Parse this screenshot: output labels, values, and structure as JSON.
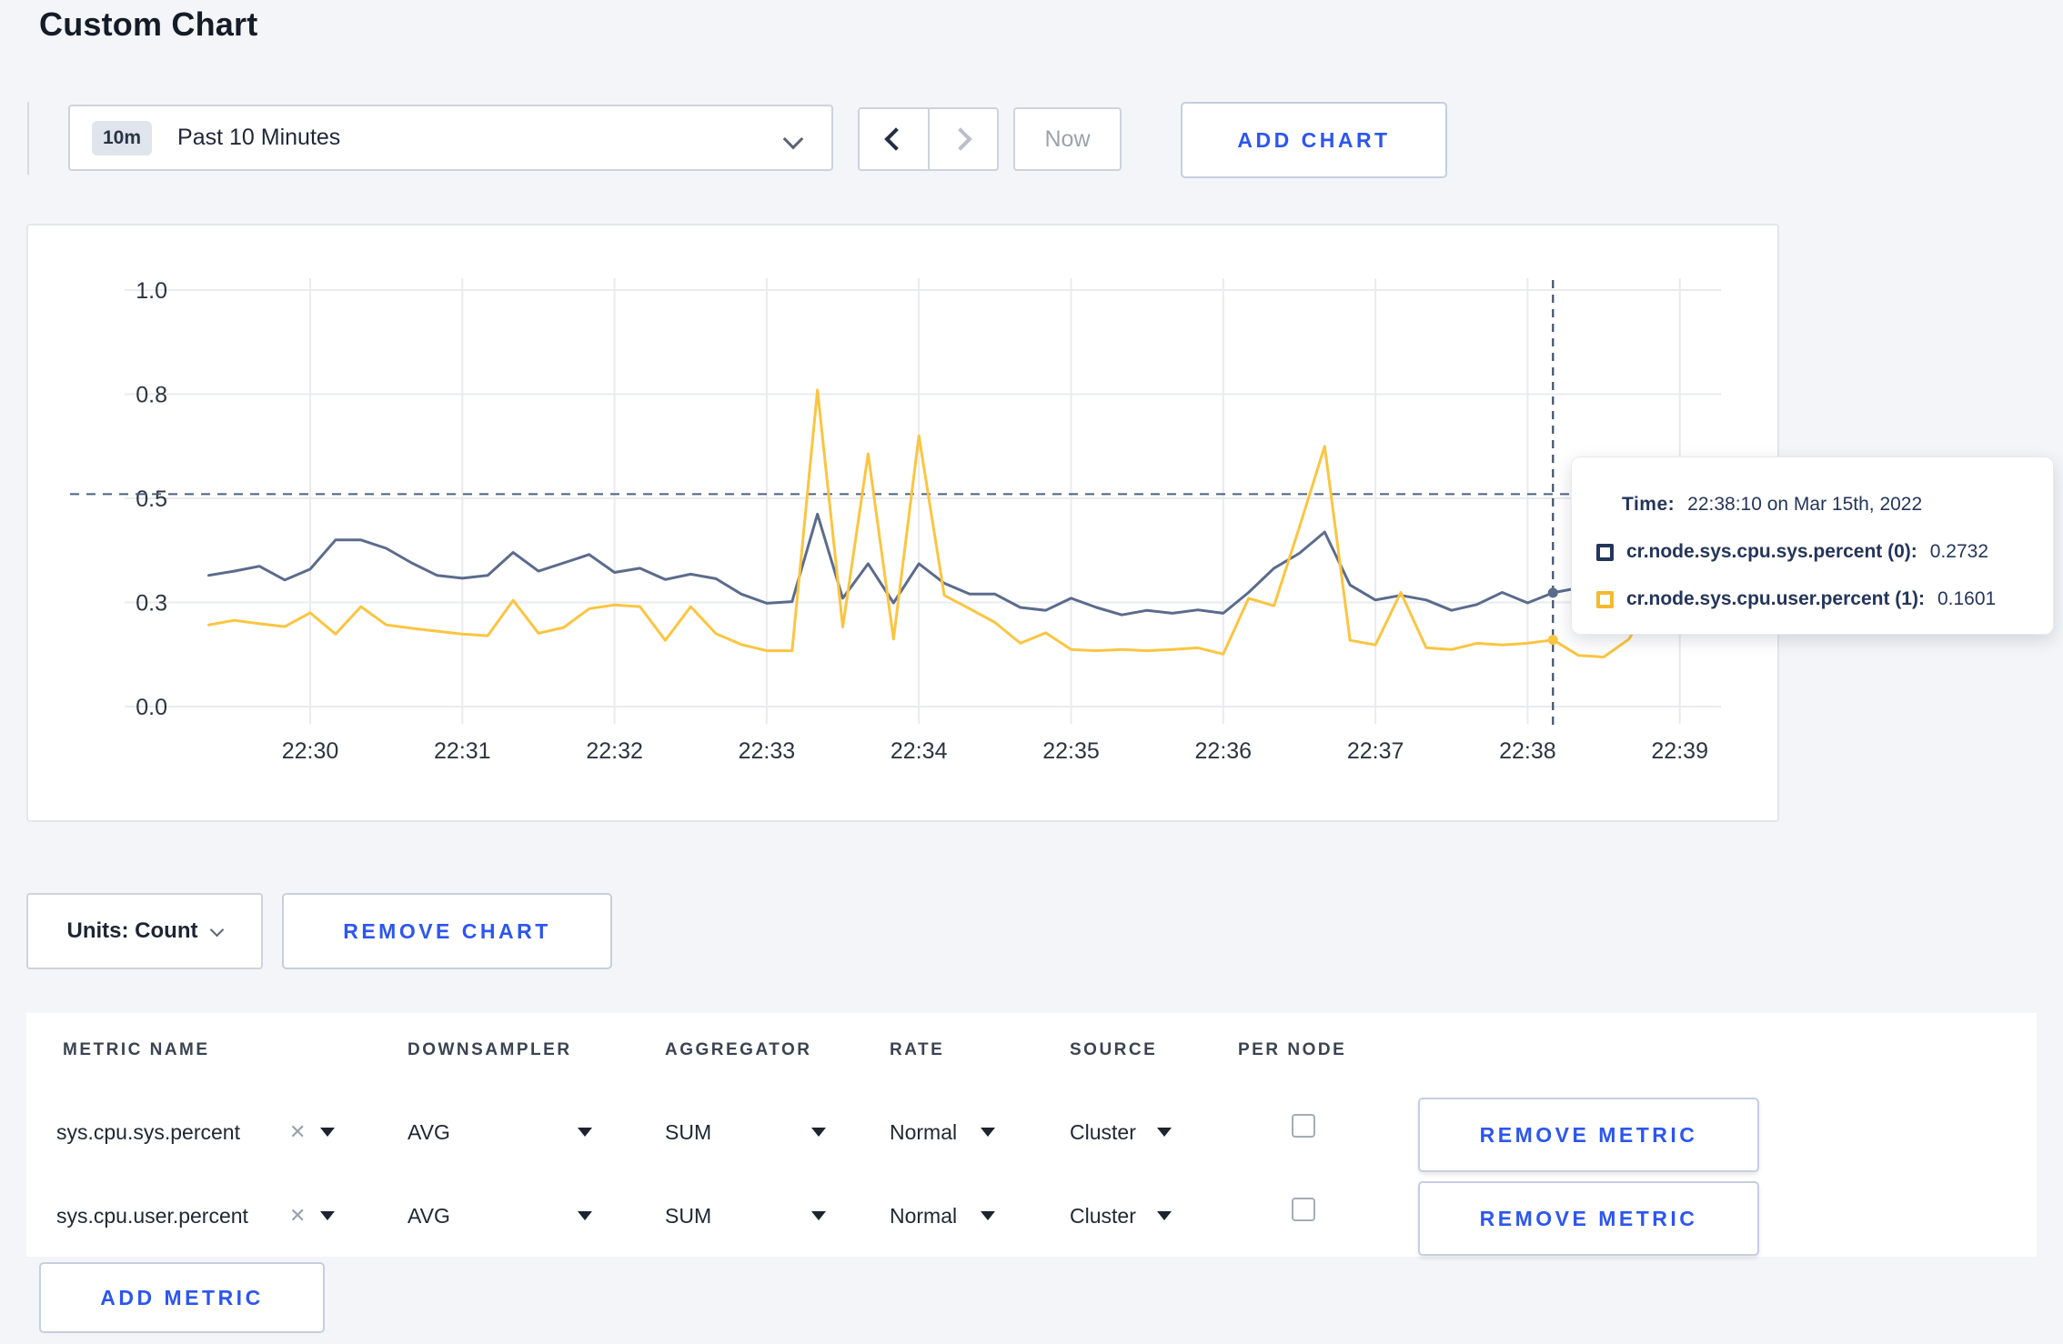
{
  "page": {
    "title": "Custom Chart",
    "background": "#f3f5f8",
    "accent_blue": "#2c56f0"
  },
  "toolbar": {
    "range_badge": "10m",
    "range_label": "Past 10 Minutes",
    "now_label": "Now",
    "add_chart_label": "ADD CHART"
  },
  "tooltip": {
    "time_label": "Time:",
    "time_value": "22:38:10 on Mar 15th, 2022",
    "series": [
      {
        "label": "cr.node.sys.cpu.sys.percent (0):",
        "value": "0.2732",
        "swatch_color": "#24355b"
      },
      {
        "label": "cr.node.sys.cpu.user.percent (1):",
        "value": "0.1601",
        "swatch_color": "#f5b92d"
      }
    ]
  },
  "chart_footer": {
    "units_label": "Units: Count",
    "remove_chart_label": "REMOVE CHART",
    "add_metric_label": "ADD METRIC"
  },
  "metrics_table": {
    "headers": [
      "METRIC NAME",
      "DOWNSAMPLER",
      "AGGREGATOR",
      "RATE",
      "SOURCE",
      "PER NODE"
    ],
    "rows": [
      {
        "name": "sys.cpu.sys.percent",
        "downsampler": "AVG",
        "aggregator": "SUM",
        "rate": "Normal",
        "source": "Cluster",
        "per_node_checked": false,
        "remove_label": "REMOVE METRIC"
      },
      {
        "name": "sys.cpu.user.percent",
        "downsampler": "AVG",
        "aggregator": "SUM",
        "rate": "Normal",
        "source": "Cluster",
        "per_node_checked": false,
        "remove_label": "REMOVE METRIC"
      }
    ]
  },
  "chart_data": {
    "type": "line",
    "title": "",
    "xlabel": "",
    "ylabel": "",
    "grid": true,
    "legend_position": "none",
    "ylim": [
      0,
      1
    ],
    "y_tick_values": [
      0,
      0.25,
      0.5,
      0.75,
      1.0
    ],
    "y_tick_labels": [
      "0.0",
      "0.3",
      "0.5",
      "0.8",
      "1.0"
    ],
    "x_ticks": [
      "22:30",
      "22:31",
      "22:32",
      "22:33",
      "22:34",
      "22:35",
      "22:36",
      "22:37",
      "22:38",
      "22:39"
    ],
    "x_start_time": "22:29:20",
    "x_end_time": "22:39:10",
    "x_interval_seconds": 10,
    "series": [
      {
        "name": "cr.node.sys.cpu.sys.percent (0)",
        "color": "#5b6b8c",
        "values": [
          0.315,
          0.325,
          0.337,
          0.304,
          0.33,
          0.4,
          0.4,
          0.38,
          0.345,
          0.315,
          0.308,
          0.315,
          0.37,
          0.325,
          0.345,
          0.365,
          0.322,
          0.332,
          0.305,
          0.318,
          0.307,
          0.27,
          0.248,
          0.252,
          0.462,
          0.26,
          0.343,
          0.249,
          0.343,
          0.296,
          0.27,
          0.27,
          0.238,
          0.231,
          0.26,
          0.238,
          0.22,
          0.231,
          0.224,
          0.232,
          0.224,
          0.274,
          0.332,
          0.368,
          0.419,
          0.292,
          0.256,
          0.267,
          0.256,
          0.231,
          0.245,
          0.274,
          0.249,
          0.2732,
          0.285,
          0.295,
          0.29,
          0.3,
          0.305,
          0.3
        ]
      },
      {
        "name": "cr.node.sys.cpu.user.percent (1)",
        "color": "#fbc541",
        "values": [
          0.196,
          0.207,
          0.199,
          0.192,
          0.225,
          0.174,
          0.24,
          0.196,
          0.188,
          0.181,
          0.174,
          0.17,
          0.255,
          0.176,
          0.19,
          0.235,
          0.244,
          0.24,
          0.159,
          0.24,
          0.175,
          0.149,
          0.134,
          0.134,
          0.76,
          0.191,
          0.607,
          0.162,
          0.65,
          0.267,
          0.235,
          0.202,
          0.152,
          0.177,
          0.137,
          0.134,
          0.137,
          0.134,
          0.137,
          0.141,
          0.126,
          0.26,
          0.242,
          0.43,
          0.625,
          0.159,
          0.148,
          0.274,
          0.141,
          0.137,
          0.152,
          0.148,
          0.152,
          0.1601,
          0.123,
          0.119,
          0.162,
          0.267,
          0.177,
          0.24
        ]
      }
    ],
    "crosshair": {
      "time": "22:38:10",
      "values": [
        0.2732,
        0.1601
      ],
      "hline_value": 0.51
    }
  }
}
